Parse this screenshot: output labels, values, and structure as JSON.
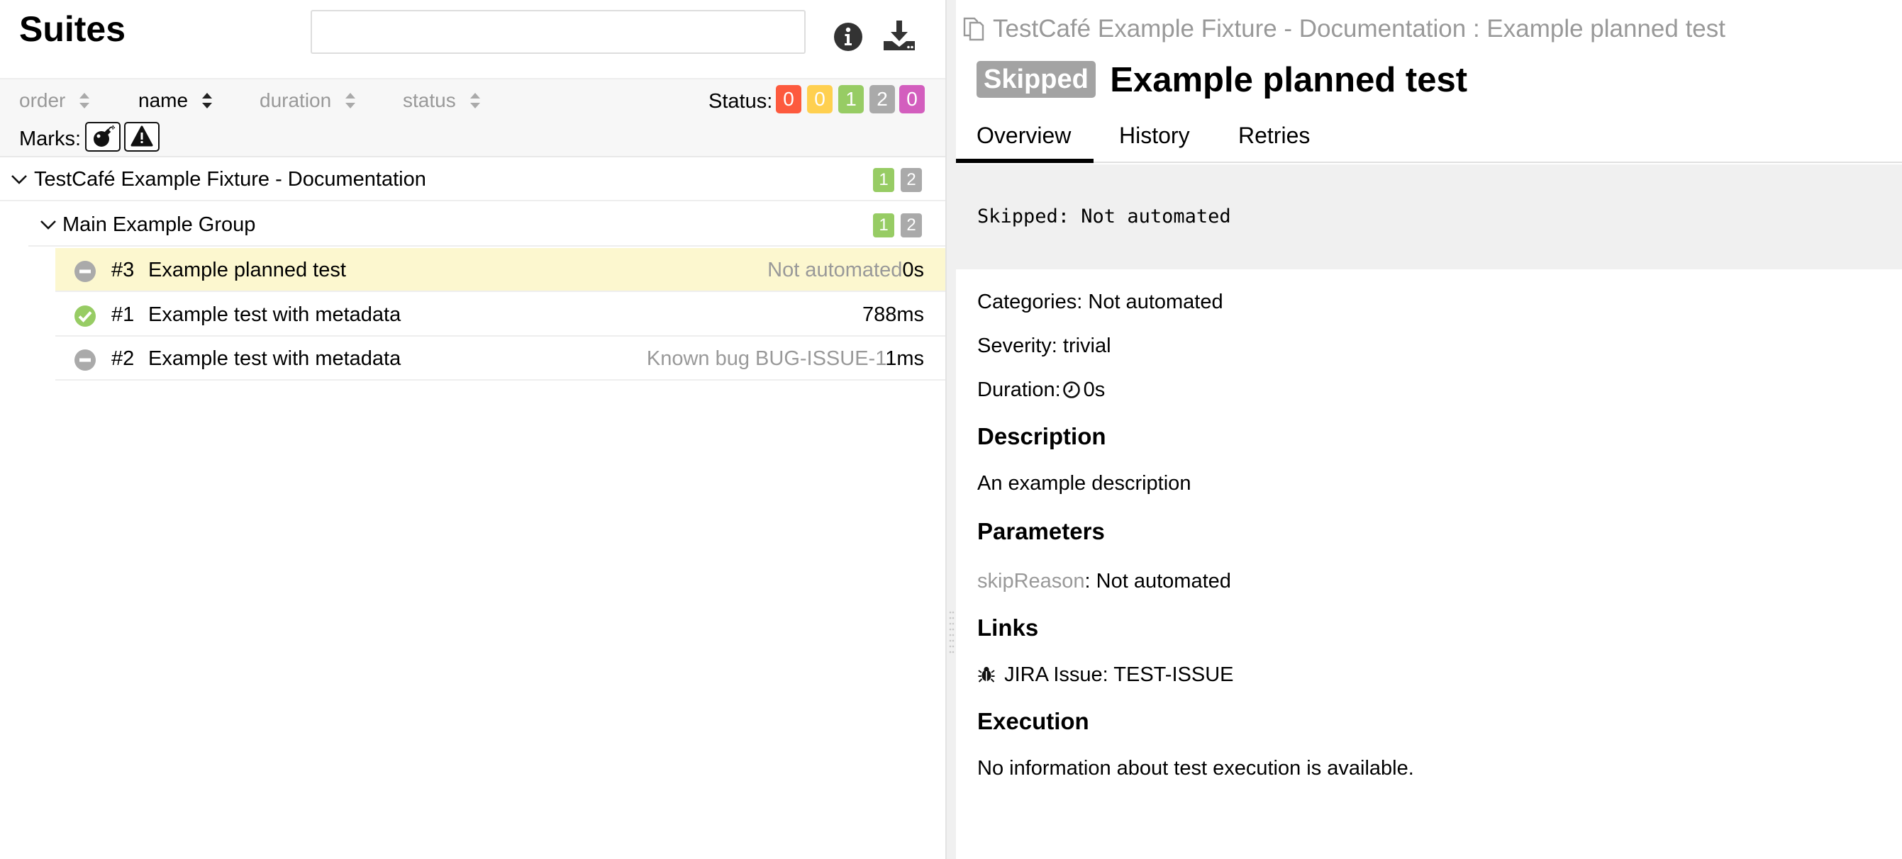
{
  "left": {
    "title": "Suites",
    "search": {
      "value": "",
      "placeholder": ""
    },
    "icons": {
      "info": "info-icon",
      "download": "download-icon"
    },
    "sort": [
      {
        "label": "order",
        "active": false
      },
      {
        "label": "name",
        "active": true
      },
      {
        "label": "duration",
        "active": false
      },
      {
        "label": "status",
        "active": false
      }
    ],
    "status_filter": {
      "label": "Status:",
      "badges": [
        {
          "status": "failed",
          "count": "0",
          "color": "#fd5a3e"
        },
        {
          "status": "broken",
          "count": "0",
          "color": "#ffd050"
        },
        {
          "status": "passed",
          "count": "1",
          "color": "#97cc64"
        },
        {
          "status": "skipped",
          "count": "2",
          "color": "#aaaaaa"
        },
        {
          "status": "unknown",
          "count": "0",
          "color": "#d35ebe"
        }
      ]
    },
    "marks": {
      "label": "Marks:",
      "items": [
        "bomb-icon",
        "warning-icon"
      ]
    },
    "tree": {
      "fixture": {
        "name": "TestCafé Example Fixture - Documentation",
        "passed": "1",
        "skipped": "2"
      },
      "group": {
        "name": "Main Example Group",
        "passed": "1",
        "skipped": "2"
      },
      "tests": [
        {
          "num": "#3",
          "name": "Example planned test",
          "info": "Not automated",
          "duration": "0s",
          "status": "skipped",
          "selected": true
        },
        {
          "num": "#1",
          "name": "Example test with metadata",
          "info": "",
          "duration": "788ms",
          "status": "passed",
          "selected": false
        },
        {
          "num": "#2",
          "name": "Example test with metadata",
          "info": "Known bug BUG-ISSUE-1",
          "duration": "1ms",
          "status": "skipped",
          "selected": false
        }
      ]
    }
  },
  "right": {
    "breadcrumb": "TestCafé Example Fixture - Documentation : Example planned test",
    "status_badge": "Skipped",
    "title": "Example planned test",
    "tabs": [
      "Overview",
      "History",
      "Retries"
    ],
    "active_tab": "Overview",
    "status_message": "Skipped: Not automated",
    "categories": {
      "label": "Categories:",
      "value": "Not automated"
    },
    "severity": {
      "label": "Severity:",
      "value": "trivial"
    },
    "duration": {
      "label": "Duration:",
      "value": "0s"
    },
    "description": {
      "heading": "Description",
      "text": "An example description"
    },
    "parameters": {
      "heading": "Parameters",
      "items": [
        {
          "key": "skipReason",
          "value": "Not automated"
        }
      ]
    },
    "links": {
      "heading": "Links",
      "items": [
        {
          "label": "JIRA Issue:",
          "value": "TEST-ISSUE",
          "icon": "bug-icon"
        }
      ]
    },
    "execution": {
      "heading": "Execution",
      "text": "No information about test execution is available."
    }
  },
  "colors": {
    "passed": "#97cc64",
    "skipped": "#aaaaaa",
    "selected_row": "#fcf7cf",
    "muted_text": "#999999"
  }
}
